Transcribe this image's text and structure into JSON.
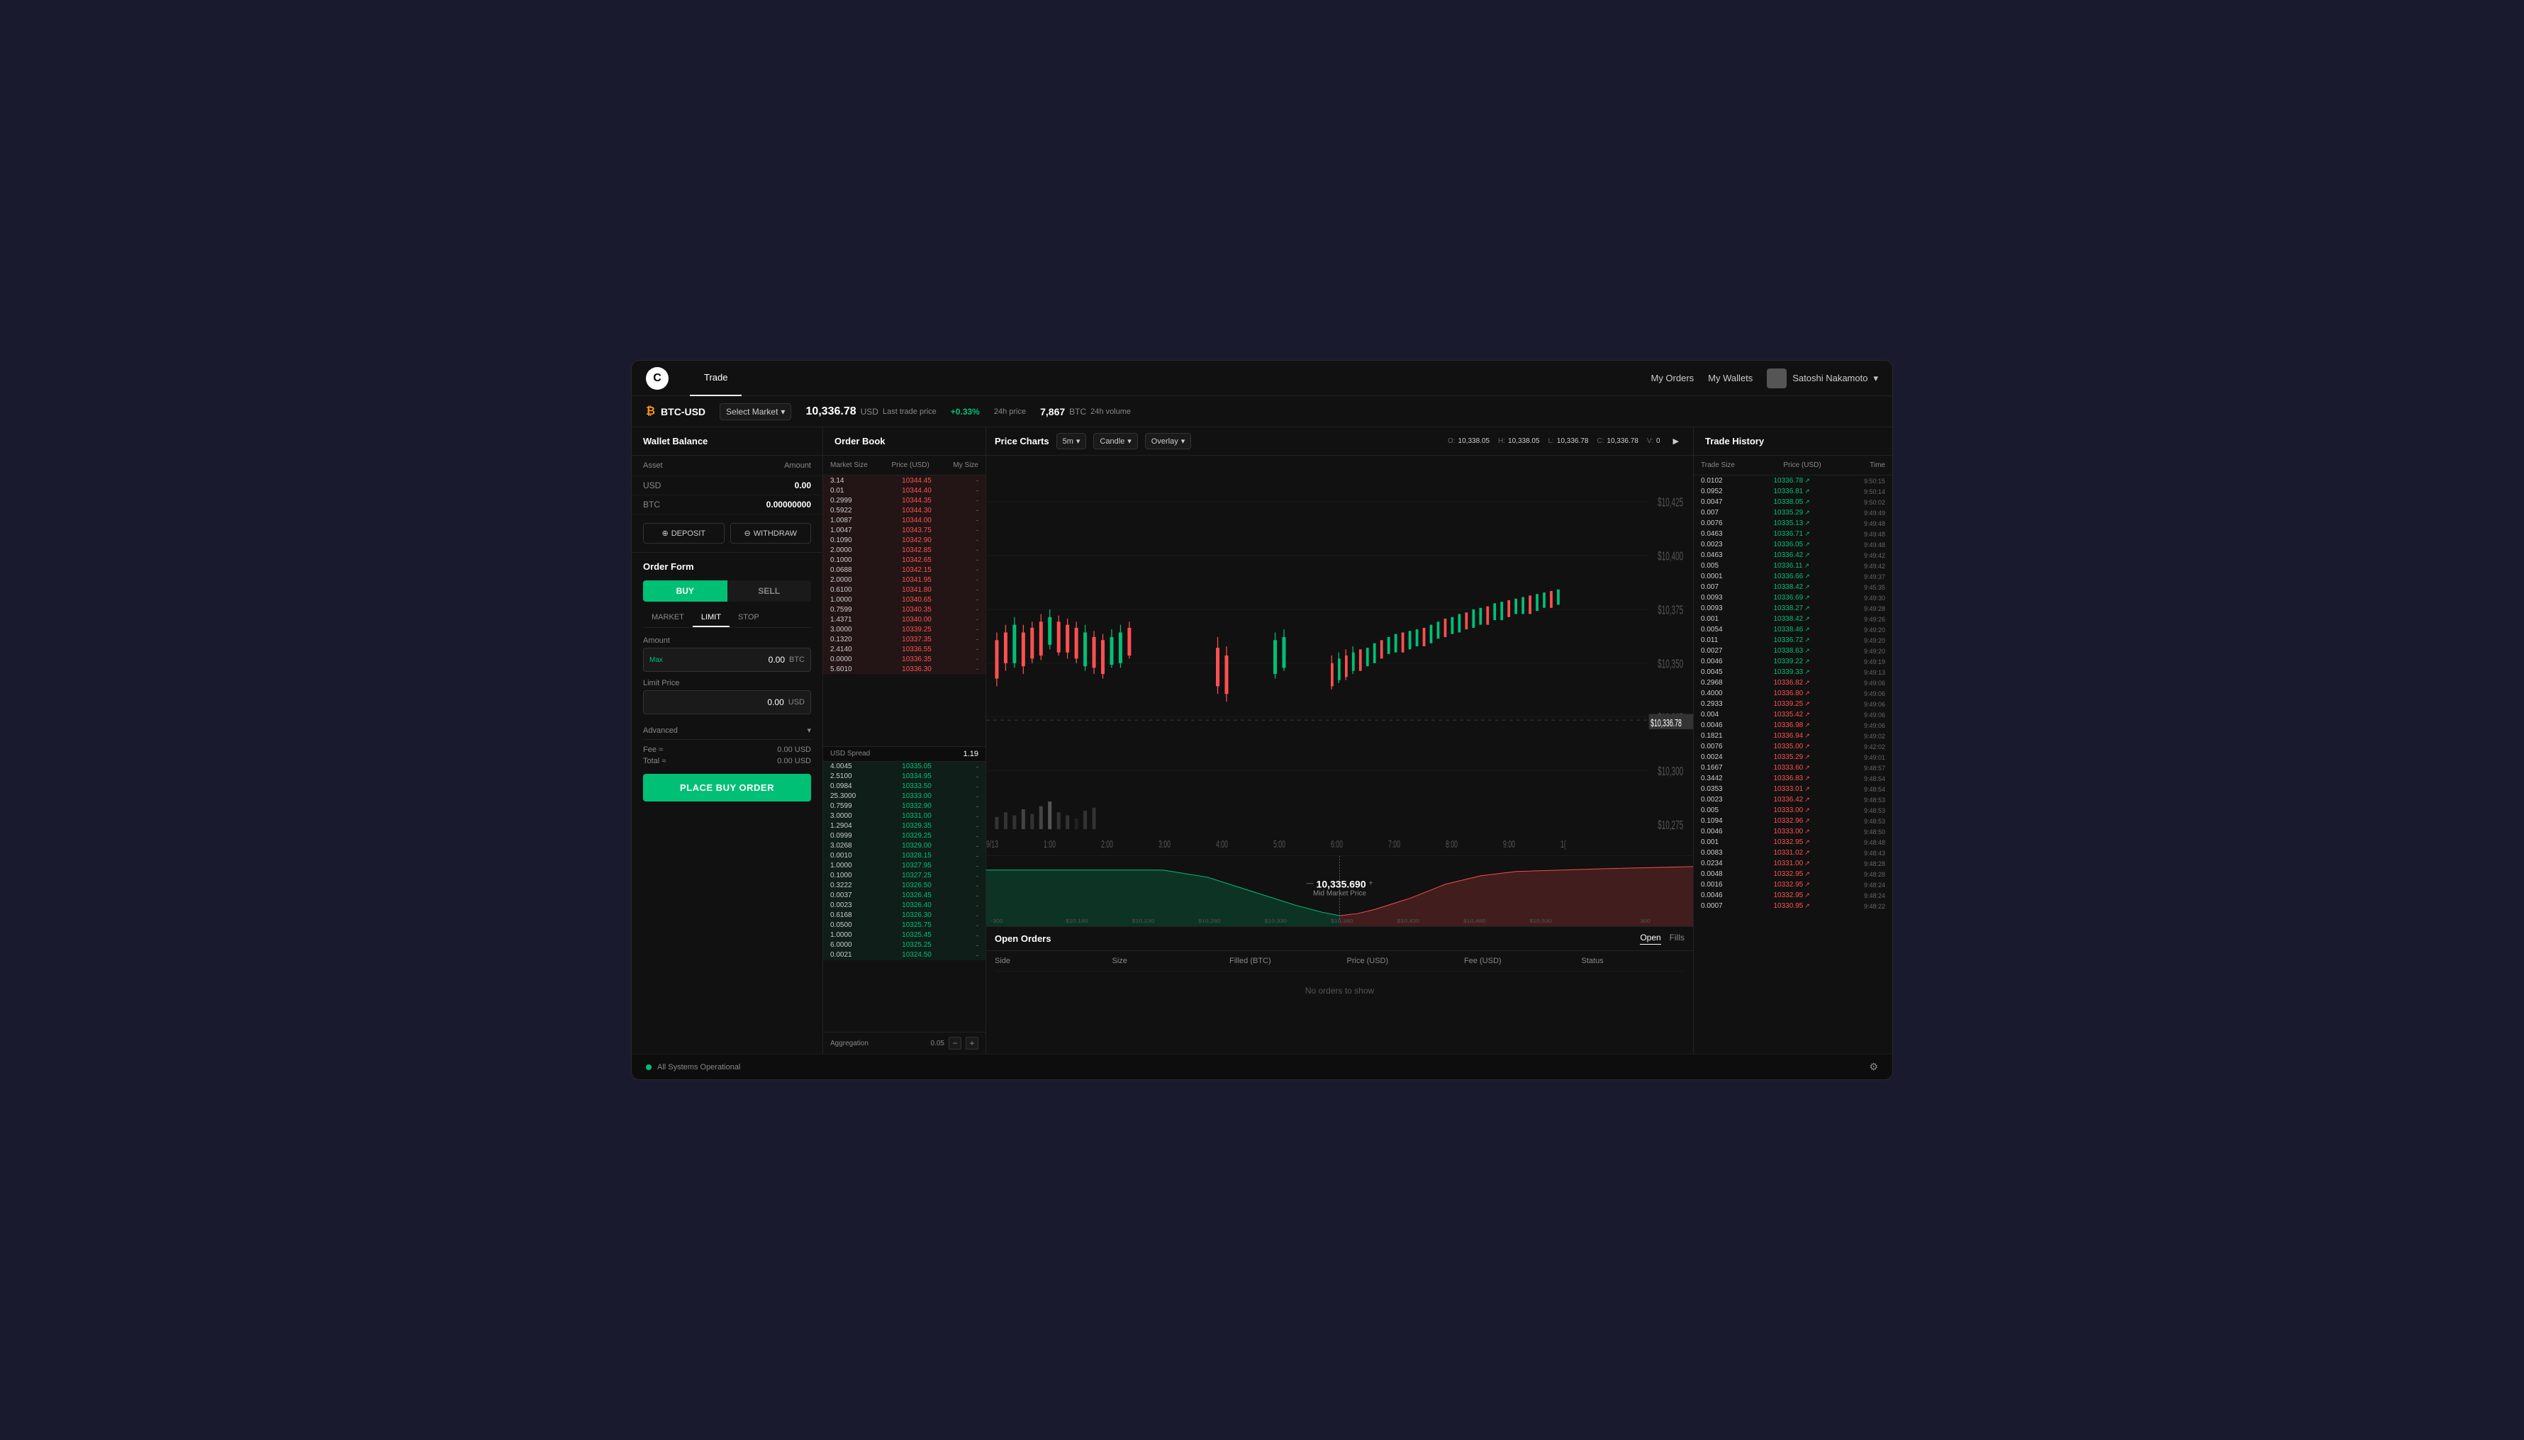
{
  "app": {
    "logo": "C",
    "nav_tabs": [
      {
        "label": "Trade",
        "active": true
      }
    ],
    "nav_right": {
      "my_orders": "My Orders",
      "my_wallets": "My Wallets",
      "user_name": "Satoshi Nakamoto"
    }
  },
  "market_bar": {
    "pair": "BTC-USD",
    "btc_symbol": "₿",
    "select_market": "Select Market",
    "last_trade_price": "10,336.78",
    "currency": "USD",
    "price_label": "Last trade price",
    "price_change": "+0.33%",
    "price_change_label": "24h price",
    "volume": "7,867",
    "volume_currency": "BTC",
    "volume_label": "24h volume"
  },
  "wallet_panel": {
    "title": "Wallet Balance",
    "col_asset": "Asset",
    "col_amount": "Amount",
    "usd_asset": "USD",
    "usd_amount": "0.00",
    "btc_asset": "BTC",
    "btc_amount": "0.00000000",
    "deposit_btn": "DEPOSIT",
    "withdraw_btn": "WITHDRAW"
  },
  "order_form": {
    "title": "Order Form",
    "buy_label": "BUY",
    "sell_label": "SELL",
    "market_tab": "MARKET",
    "limit_tab": "LIMIT",
    "stop_tab": "STOP",
    "active_tab": "LIMIT",
    "amount_label": "Amount",
    "max_label": "Max",
    "amount_value": "0.00",
    "amount_unit": "BTC",
    "limit_price_label": "Limit Price",
    "limit_price_value": "0.00",
    "limit_price_unit": "USD",
    "advanced_label": "Advanced",
    "fee_label": "Fee ≈",
    "fee_value": "0.00 USD",
    "total_label": "Total ≈",
    "total_value": "0.00 USD",
    "place_order_btn": "PLACE BUY ORDER"
  },
  "order_book": {
    "title": "Order Book",
    "col_market_size": "Market Size",
    "col_price_usd": "Price (USD)",
    "col_my_size": "My Size",
    "spread_label": "USD Spread",
    "spread_value": "1.19",
    "aggregation_label": "Aggregation",
    "aggregation_value": "0.05",
    "asks": [
      {
        "size": "3.14",
        "price": "10344.45",
        "my_size": "-"
      },
      {
        "size": "0.01",
        "price": "10344.40",
        "my_size": "-"
      },
      {
        "size": "0.2999",
        "price": "10344.35",
        "my_size": "-"
      },
      {
        "size": "0.5922",
        "price": "10344.30",
        "my_size": "-"
      },
      {
        "size": "1.0087",
        "price": "10344.00",
        "my_size": "-"
      },
      {
        "size": "1.0047",
        "price": "10343.75",
        "my_size": "-"
      },
      {
        "size": "0.1090",
        "price": "10342.90",
        "my_size": "-"
      },
      {
        "size": "2.0000",
        "price": "10342.85",
        "my_size": "-"
      },
      {
        "size": "0.1000",
        "price": "10342.65",
        "my_size": "-"
      },
      {
        "size": "0.0688",
        "price": "10342.15",
        "my_size": "-"
      },
      {
        "size": "2.0000",
        "price": "10341.95",
        "my_size": "-"
      },
      {
        "size": "0.6100",
        "price": "10341.80",
        "my_size": "-"
      },
      {
        "size": "1.0000",
        "price": "10340.65",
        "my_size": "-"
      },
      {
        "size": "0.7599",
        "price": "10340.35",
        "my_size": "-"
      },
      {
        "size": "1.4371",
        "price": "10340.00",
        "my_size": "-"
      },
      {
        "size": "3.0000",
        "price": "10339.25",
        "my_size": "-"
      },
      {
        "size": "0.1320",
        "price": "10337.35",
        "my_size": "-"
      },
      {
        "size": "2.4140",
        "price": "10336.55",
        "my_size": "-"
      },
      {
        "size": "0.0000",
        "price": "10336.35",
        "my_size": "-"
      },
      {
        "size": "5.6010",
        "price": "10336.30",
        "my_size": "-"
      }
    ],
    "bids": [
      {
        "size": "4.0045",
        "price": "10335.05",
        "my_size": "-"
      },
      {
        "size": "2.5100",
        "price": "10334.95",
        "my_size": "-"
      },
      {
        "size": "0.0984",
        "price": "10333.50",
        "my_size": "-"
      },
      {
        "size": "25.3000",
        "price": "10333.00",
        "my_size": "-"
      },
      {
        "size": "0.7599",
        "price": "10332.90",
        "my_size": "-"
      },
      {
        "size": "3.0000",
        "price": "10331.00",
        "my_size": "-"
      },
      {
        "size": "1.2904",
        "price": "10329.35",
        "my_size": "-"
      },
      {
        "size": "0.0999",
        "price": "10329.25",
        "my_size": "-"
      },
      {
        "size": "3.0268",
        "price": "10329.00",
        "my_size": "-"
      },
      {
        "size": "0.0010",
        "price": "10328.15",
        "my_size": "-"
      },
      {
        "size": "1.0000",
        "price": "10327.95",
        "my_size": "-"
      },
      {
        "size": "0.1000",
        "price": "10327.25",
        "my_size": "-"
      },
      {
        "size": "0.3222",
        "price": "10326.50",
        "my_size": "-"
      },
      {
        "size": "0.0037",
        "price": "10326.45",
        "my_size": "-"
      },
      {
        "size": "0.0023",
        "price": "10326.40",
        "my_size": "-"
      },
      {
        "size": "0.6168",
        "price": "10326.30",
        "my_size": "-"
      },
      {
        "size": "0.0500",
        "price": "10325.75",
        "my_size": "-"
      },
      {
        "size": "1.0000",
        "price": "10325.45",
        "my_size": "-"
      },
      {
        "size": "6.0000",
        "price": "10325.25",
        "my_size": "-"
      },
      {
        "size": "0.0021",
        "price": "10324.50",
        "my_size": "-"
      }
    ]
  },
  "price_charts": {
    "title": "Price Charts",
    "timeframe": "5m",
    "chart_type": "Candle",
    "overlay_label": "Overlay",
    "ohlcv": {
      "o": "10,338.05",
      "h": "10,338.05",
      "l": "10,336.78",
      "c": "10,336.78",
      "v": "0"
    },
    "y_labels": [
      "$10,425",
      "$10,400",
      "$10,375",
      "$10,350",
      "$10,325",
      "$10,300",
      "$10,275"
    ],
    "x_labels": [
      "9/13",
      "1:00",
      "2:00",
      "3:00",
      "4:00",
      "5:00",
      "6:00",
      "7:00",
      "8:00",
      "9:00",
      "1("
    ],
    "depth_x_labels": [
      "-300",
      "$10,180",
      "$10,230",
      "$10,280",
      "$10,330",
      "$10,380",
      "$10,430",
      "$10,480",
      "$10,530",
      "300"
    ],
    "current_price": "$10,336.78",
    "mid_market_price": "10,335.690",
    "mid_market_label": "Mid Market Price"
  },
  "open_orders": {
    "title": "Open Orders",
    "open_tab": "Open",
    "fills_tab": "Fills",
    "col_side": "Side",
    "col_size": "Size",
    "col_filled": "Filled (BTC)",
    "col_price": "Price (USD)",
    "col_fee": "Fee (USD)",
    "col_status": "Status",
    "no_orders_text": "No orders to show"
  },
  "trade_history": {
    "title": "Trade History",
    "col_trade_size": "Trade Size",
    "col_price_usd": "Price (USD)",
    "col_time": "Time",
    "trades": [
      {
        "size": "0.0102",
        "price": "10336.78",
        "direction": "up",
        "time": "9:50:15"
      },
      {
        "size": "0.0952",
        "price": "10336.81",
        "direction": "up",
        "time": "9:50:14"
      },
      {
        "size": "0.0047",
        "price": "10338.05",
        "direction": "up",
        "time": "9:50:02"
      },
      {
        "size": "0.007",
        "price": "10335.29",
        "direction": "up",
        "time": "9:49:49"
      },
      {
        "size": "0.0076",
        "price": "10335.13",
        "direction": "up",
        "time": "9:49:48"
      },
      {
        "size": "0.0463",
        "price": "10336.71",
        "direction": "up",
        "time": "9:49:48"
      },
      {
        "size": "0.0023",
        "price": "10336.05",
        "direction": "up",
        "time": "9:49:48"
      },
      {
        "size": "0.0463",
        "price": "10336.42",
        "direction": "up",
        "time": "9:49:42"
      },
      {
        "size": "0.005",
        "price": "10336.11",
        "direction": "up",
        "time": "9:49:42"
      },
      {
        "size": "0.0001",
        "price": "10336.66",
        "direction": "up",
        "time": "9:49:37"
      },
      {
        "size": "0.007",
        "price": "10338.42",
        "direction": "up",
        "time": "9:45:35"
      },
      {
        "size": "0.0093",
        "price": "10336.69",
        "direction": "up",
        "time": "9:49:30"
      },
      {
        "size": "0.0093",
        "price": "10338.27",
        "direction": "up",
        "time": "9:49:28"
      },
      {
        "size": "0.001",
        "price": "10338.42",
        "direction": "up",
        "time": "9:49:26"
      },
      {
        "size": "0.0054",
        "price": "10338.46",
        "direction": "up",
        "time": "9:49:20"
      },
      {
        "size": "0.011",
        "price": "10336.72",
        "direction": "up",
        "time": "9:49:20"
      },
      {
        "size": "0.0027",
        "price": "10338.63",
        "direction": "up",
        "time": "9:49:20"
      },
      {
        "size": "0.0046",
        "price": "10339.22",
        "direction": "up",
        "time": "9:49:19"
      },
      {
        "size": "0.0045",
        "price": "10339.33",
        "direction": "up",
        "time": "9:49:13"
      },
      {
        "size": "0.2968",
        "price": "10336.82",
        "direction": "down",
        "time": "9:49:06"
      },
      {
        "size": "0.4000",
        "price": "10336.80",
        "direction": "down",
        "time": "9:49:06"
      },
      {
        "size": "0.2933",
        "price": "10339.25",
        "direction": "down",
        "time": "9:49:06"
      },
      {
        "size": "0.004",
        "price": "10335.42",
        "direction": "down",
        "time": "9:49:06"
      },
      {
        "size": "0.0046",
        "price": "10336.98",
        "direction": "down",
        "time": "9:49:06"
      },
      {
        "size": "0.1821",
        "price": "10336.94",
        "direction": "down",
        "time": "9:49:02"
      },
      {
        "size": "0.0076",
        "price": "10335.00",
        "direction": "down",
        "time": "9:42:02"
      },
      {
        "size": "0.0024",
        "price": "10335.29",
        "direction": "down",
        "time": "9:49:01"
      },
      {
        "size": "0.1667",
        "price": "10333.60",
        "direction": "down",
        "time": "9:48:57"
      },
      {
        "size": "0.3442",
        "price": "10336.83",
        "direction": "down",
        "time": "9:48:54"
      },
      {
        "size": "0.0353",
        "price": "10333.01",
        "direction": "down",
        "time": "9:48:54"
      },
      {
        "size": "0.0023",
        "price": "10336.42",
        "direction": "down",
        "time": "9:48:53"
      },
      {
        "size": "0.005",
        "price": "10333.00",
        "direction": "down",
        "time": "9:48:53"
      },
      {
        "size": "0.1094",
        "price": "10332.96",
        "direction": "down",
        "time": "9:48:53"
      },
      {
        "size": "0.0046",
        "price": "10333.00",
        "direction": "down",
        "time": "9:48:50"
      },
      {
        "size": "0.001",
        "price": "10332.95",
        "direction": "down",
        "time": "9:48:48"
      },
      {
        "size": "0.0083",
        "price": "10331.02",
        "direction": "down",
        "time": "9:48:43"
      },
      {
        "size": "0.0234",
        "price": "10331.00",
        "direction": "down",
        "time": "9:48:28"
      },
      {
        "size": "0.0048",
        "price": "10332.95",
        "direction": "down",
        "time": "9:48:28"
      },
      {
        "size": "0.0016",
        "price": "10332.95",
        "direction": "down",
        "time": "9:48:24"
      },
      {
        "size": "0.0046",
        "price": "10332.95",
        "direction": "down",
        "time": "9:48:24"
      },
      {
        "size": "0.0007",
        "price": "10330.95",
        "direction": "down",
        "time": "9:48:22"
      }
    ]
  },
  "status_bar": {
    "status_text": "All Systems Operational",
    "settings_icon": "⚙"
  }
}
